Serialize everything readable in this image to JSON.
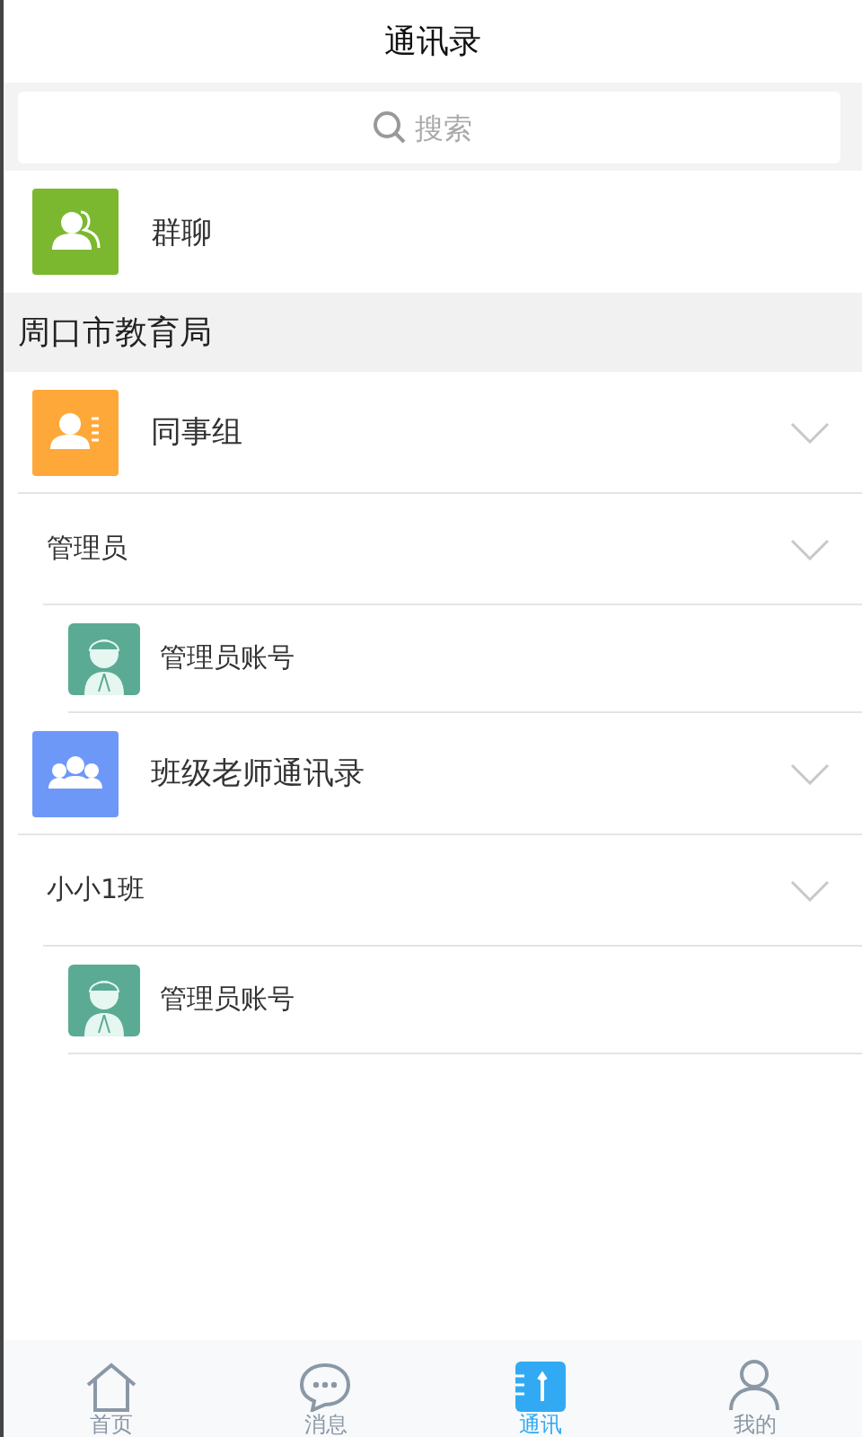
{
  "title": "通讯录",
  "search": {
    "placeholder": "搜索"
  },
  "group_chat": {
    "label": "群聊",
    "color": "#7cb82f"
  },
  "section": {
    "title": "周口市教育局"
  },
  "groups": [
    {
      "name": "同事组",
      "kind": "card",
      "color": "#ffa83a",
      "subgroups": [
        {
          "name": "管理员",
          "members": [
            {
              "name": "管理员账号"
            }
          ]
        }
      ]
    },
    {
      "name": "班级老师通讯录",
      "kind": "people",
      "color": "#6e98f8",
      "subgroups": [
        {
          "name": "小小1班",
          "members": [
            {
              "name": "管理员账号"
            }
          ]
        }
      ]
    }
  ],
  "tabs": [
    {
      "label": "首页",
      "kind": "home",
      "selected": false
    },
    {
      "label": "消息",
      "kind": "chat",
      "selected": false
    },
    {
      "label": "通讯",
      "kind": "contacts",
      "selected": true
    },
    {
      "label": "我的",
      "kind": "user",
      "selected": false
    }
  ]
}
